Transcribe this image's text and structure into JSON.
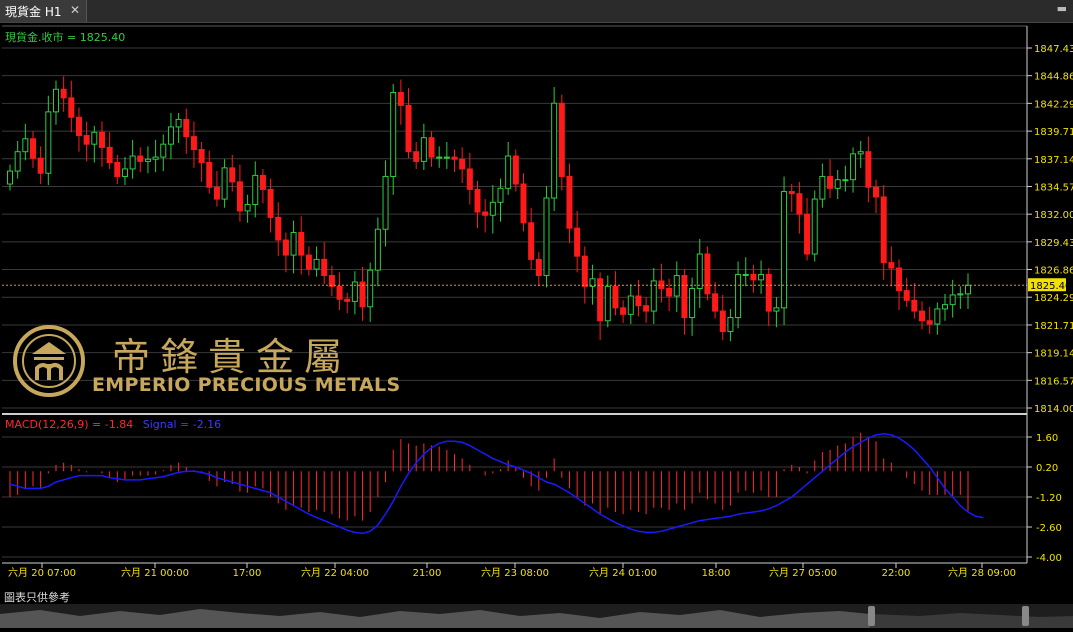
{
  "tab": {
    "title": "現貨金 H1",
    "close": "✕"
  },
  "main_legend": "現貨金.收市 = 1825.40",
  "macd_legend": {
    "macd": "MACD(12,26,9) = -1.84",
    "signal": "Signal = -2.16"
  },
  "current_price": "1825.40",
  "price_axis": [
    "1847.43",
    "1844.86",
    "1842.29",
    "1839.71",
    "1837.14",
    "1834.57",
    "1832.00",
    "1829.43",
    "1826.86",
    "1824.29",
    "1821.71",
    "1819.14",
    "1816.57",
    "1814.00"
  ],
  "macd_axis": [
    "1.60",
    "0.20",
    "-1.20",
    "-2.60",
    "-4.00"
  ],
  "time_axis": [
    "六月 20 07:00",
    "六月 21 00:00",
    "17:00",
    "六月 22 04:00",
    "21:00",
    "六月 23 08:00",
    "六月 24 01:00",
    "18:00",
    "六月 27 05:00",
    "22:00",
    "六月 28 09:00"
  ],
  "logo": {
    "cn": "帝鋒貴金屬",
    "en": "EMPERIO PRECIOUS METALS"
  },
  "footer_note": "圖表只供參考",
  "colors": {
    "up": "#2ecc40",
    "down": "#ff1a1a",
    "axis_text": "#f2e200",
    "signal": "#1a1aff",
    "hist": "#ff2a2a",
    "price_line": "#f0a000"
  },
  "chart_data": {
    "type": "candlestick",
    "ylim": [
      1814.0,
      1848.7
    ],
    "close": [
      1836.0,
      1837.8,
      1839.0,
      1837.2,
      1835.8,
      1841.5,
      1843.6,
      1842.8,
      1841.0,
      1839.3,
      1838.5,
      1839.6,
      1838.2,
      1836.8,
      1835.5,
      1836.2,
      1837.4,
      1836.9,
      1837.1,
      1837.3,
      1838.5,
      1840.1,
      1840.8,
      1839.2,
      1838.0,
      1836.8,
      1834.5,
      1833.4,
      1836.3,
      1835.0,
      1832.3,
      1832.9,
      1835.6,
      1834.3,
      1831.7,
      1829.6,
      1828.2,
      1830.3,
      1828.2,
      1826.9,
      1827.8,
      1826.3,
      1825.3,
      1824.1,
      1823.9,
      1825.7,
      1823.4,
      1826.8,
      1830.6,
      1835.5,
      1843.3,
      1842.1,
      1837.8,
      1836.9,
      1839.1,
      1837.3,
      1837.3,
      1837.3,
      1837.1,
      1836.2,
      1834.3,
      1832.2,
      1831.9,
      1833.1,
      1834.4,
      1837.4,
      1834.8,
      1831.2,
      1827.8,
      1826.3,
      1833.5,
      1842.3,
      1835.5,
      1830.7,
      1828.1,
      1825.3,
      1826.0,
      1822.1,
      1825.3,
      1823.3,
      1822.7,
      1824.4,
      1823.5,
      1823.0,
      1825.8,
      1825.1,
      1824.4,
      1826.3,
      1822.4,
      1825.1,
      1828.3,
      1824.6,
      1823.0,
      1821.1,
      1822.4,
      1826.4,
      1826.4,
      1825.9,
      1826.4,
      1823.0,
      1823.3,
      1834.1,
      1833.9,
      1832.0,
      1828.3,
      1833.4,
      1835.5,
      1834.4,
      1835.2,
      1835.2,
      1837.6,
      1837.8,
      1834.5,
      1833.6,
      1827.5,
      1827.0,
      1824.9,
      1824.0,
      1823.0,
      1822.1,
      1821.8,
      1823.2,
      1823.6,
      1824.5,
      1824.6,
      1825.4
    ],
    "macd_hist": [
      -1.2,
      -1.1,
      -0.8,
      -0.7,
      -0.8,
      -0.1,
      0.3,
      0.4,
      0.3,
      0.1,
      -0.05,
      0.0,
      -0.1,
      -0.3,
      -0.5,
      -0.4,
      -0.2,
      -0.2,
      -0.2,
      -0.15,
      0.05,
      0.3,
      0.4,
      0.2,
      0.05,
      -0.1,
      -0.45,
      -0.7,
      -0.5,
      -0.6,
      -0.95,
      -1.0,
      -0.7,
      -0.8,
      -1.2,
      -1.5,
      -1.8,
      -1.6,
      -1.7,
      -1.9,
      -1.8,
      -1.9,
      -2.0,
      -2.2,
      -2.3,
      -2.1,
      -2.3,
      -1.9,
      -1.2,
      -0.5,
      1.0,
      1.5,
      1.3,
      1.2,
      1.3,
      1.2,
      1.15,
      1.0,
      0.8,
      0.6,
      0.3,
      0.0,
      -0.2,
      -0.1,
      0.1,
      0.5,
      0.2,
      -0.3,
      -0.7,
      -0.9,
      -0.3,
      0.6,
      -0.3,
      -0.8,
      -1.2,
      -1.6,
      -1.5,
      -2.0,
      -1.7,
      -1.9,
      -2.0,
      -1.8,
      -1.9,
      -2.0,
      -1.7,
      -1.7,
      -1.8,
      -1.5,
      -1.8,
      -1.5,
      -1.0,
      -1.3,
      -1.5,
      -1.8,
      -1.6,
      -1.0,
      -0.9,
      -1.0,
      -0.9,
      -1.2,
      -1.2,
      0.1,
      0.3,
      0.2,
      -0.1,
      0.5,
      0.9,
      1.0,
      1.2,
      1.3,
      1.6,
      1.8,
      1.6,
      1.4,
      0.6,
      0.4,
      0.0,
      -0.3,
      -0.6,
      -0.9,
      -1.1,
      -1.1,
      -1.1,
      -1.2,
      -1.1,
      -1.84
    ],
    "signal": [
      -0.6,
      -0.7,
      -0.8,
      -0.8,
      -0.8,
      -0.7,
      -0.5,
      -0.4,
      -0.3,
      -0.2,
      -0.2,
      -0.2,
      -0.2,
      -0.3,
      -0.35,
      -0.4,
      -0.4,
      -0.4,
      -0.35,
      -0.3,
      -0.25,
      -0.15,
      -0.05,
      0.0,
      0.0,
      -0.05,
      -0.15,
      -0.3,
      -0.4,
      -0.5,
      -0.6,
      -0.7,
      -0.8,
      -0.9,
      -1.0,
      -1.2,
      -1.4,
      -1.6,
      -1.8,
      -2.0,
      -2.15,
      -2.3,
      -2.45,
      -2.6,
      -2.75,
      -2.85,
      -2.9,
      -2.8,
      -2.5,
      -2.0,
      -1.4,
      -0.7,
      -0.1,
      0.4,
      0.8,
      1.1,
      1.3,
      1.4,
      1.4,
      1.35,
      1.2,
      1.0,
      0.8,
      0.6,
      0.45,
      0.3,
      0.2,
      0.05,
      -0.1,
      -0.3,
      -0.5,
      -0.6,
      -0.8,
      -1.0,
      -1.25,
      -1.5,
      -1.75,
      -2.0,
      -2.2,
      -2.4,
      -2.55,
      -2.7,
      -2.8,
      -2.85,
      -2.85,
      -2.8,
      -2.7,
      -2.6,
      -2.5,
      -2.4,
      -2.3,
      -2.25,
      -2.2,
      -2.15,
      -2.1,
      -2.0,
      -1.95,
      -1.9,
      -1.85,
      -1.75,
      -1.6,
      -1.4,
      -1.2,
      -0.9,
      -0.6,
      -0.3,
      0.0,
      0.3,
      0.6,
      0.9,
      1.15,
      1.35,
      1.55,
      1.7,
      1.75,
      1.7,
      1.55,
      1.3,
      1.0,
      0.6,
      0.2,
      -0.3,
      -0.8,
      -1.2,
      -1.6,
      -1.9,
      -2.1,
      -2.16
    ]
  }
}
